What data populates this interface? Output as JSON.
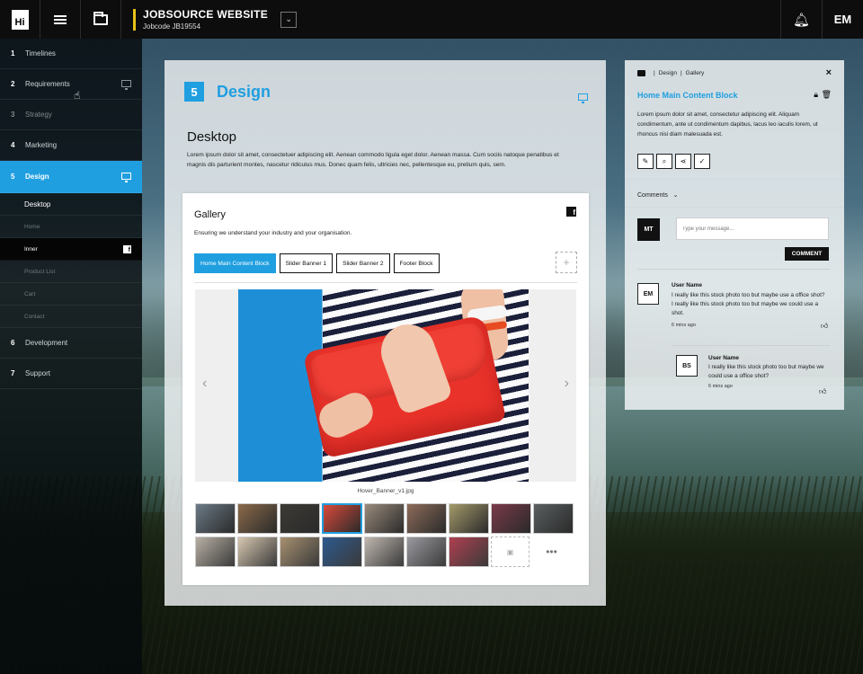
{
  "app": {
    "logo_text": "Hi",
    "project_title": "JOBSOURCE WEBSITE",
    "project_jobcode": "Jobcode JB19554",
    "user_initials": "EM"
  },
  "sidebar": {
    "items": [
      {
        "num": "1",
        "label": "Timelines"
      },
      {
        "num": "2",
        "label": "Requirements"
      },
      {
        "num": "3",
        "label": "Strategy"
      },
      {
        "num": "4",
        "label": "Marketing"
      },
      {
        "num": "5",
        "label": "Design"
      },
      {
        "num": "6",
        "label": "Development"
      },
      {
        "num": "7",
        "label": "Support"
      }
    ],
    "subitems": [
      "Desktop",
      "Home",
      "Inner",
      "Product List",
      "Cart",
      "Contact"
    ]
  },
  "main": {
    "step_number": "5",
    "title": "Design",
    "section_title": "Desktop",
    "section_text": "Lorem ipsum dolor sit amet, consectetuer adipiscing elit. Aenean commodo ligula eget dolor. Aenean massa.  Cum sociis natoque penatibus et magnis dis parturient montes, nascetur ridiculus mus. Donec quam felis, ultricies nec, pellentesque eu, pretium quis, sem.",
    "gallery": {
      "title": "Gallery",
      "subtitle": "Ensuring we understand your industry and your organisation.",
      "tabs": [
        "Home Main Content Block",
        "Slider Banner 1",
        "Slider Banner 2",
        "Footer Block"
      ],
      "image_caption": "Hover_Banner_v1.jpg",
      "thumb_colors_row1": [
        "#6b7a86",
        "#8a6a4a",
        "#3c3a34",
        "#d94a3a",
        "#9a8a7c",
        "#8d6c5a",
        "#a49a6a",
        "#7a3a4a",
        "#5a5f60"
      ],
      "thumb_colors_row2": [
        "#b8b0a4",
        "#d8c8b0",
        "#a89070",
        "#2d5a8e",
        "#c0b8b0",
        "#9a9aa0",
        "#b04050"
      ]
    }
  },
  "detail": {
    "breadcrumb": [
      "Design",
      "Gallery"
    ],
    "block_title": "Home Main Content Block",
    "block_text": "Lorem ipsum dolor sit amet, consectetur adipiscing elit. Aliquam condimentum, ante ut condimentum dapibus, lacus leo iaculis lorem, ut rhoncus nisi diam malesuada est.",
    "comments_label": "Comments",
    "my_initials": "MT",
    "message_placeholder": "Type your message...",
    "comment_button": "COMMENT",
    "comments": [
      {
        "initials": "EM",
        "name": "User Name",
        "text": "I really like this stock photo too but maybe use a office shot? I really like this stock photo too but maybe we could use a shot.",
        "time": "6 mins ago"
      },
      {
        "initials": "BS",
        "name": "User Name",
        "text": "I really like this stock photo too but maybe we could use a office shot?",
        "time": "6 mins ago"
      }
    ]
  },
  "colors": {
    "accent": "#1f9fe0",
    "topbar": "#0d0d0d",
    "yellow_marker": "#e8c21a"
  }
}
